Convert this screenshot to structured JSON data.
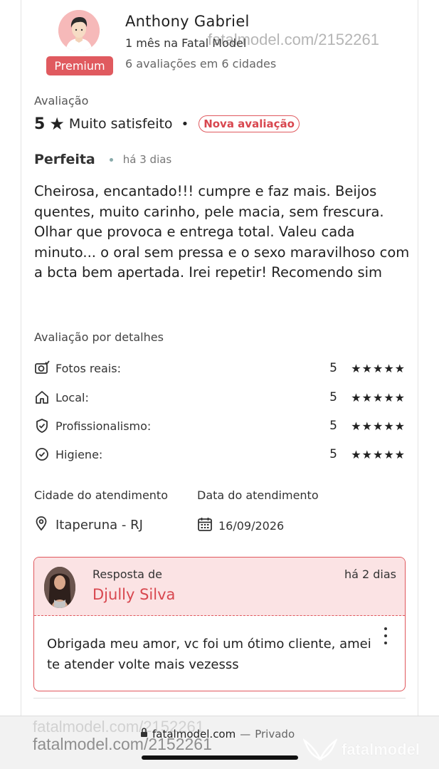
{
  "reviewer": {
    "name": "Anthony Gabriel",
    "member_since": "1 mês na Fatal Model",
    "review_count": "6 avaliações em 6 cidades",
    "badge": "Premium"
  },
  "watermark": {
    "top": "fatalmodel.com/2152261",
    "bottom": "fatalmodel.com/2152261",
    "bottom_faint": "fatalmodel.com/2152261",
    "brand": "fatalmodel"
  },
  "rating": {
    "label": "Avaliação",
    "score": "5",
    "star_icon": "star-icon",
    "text": "Muito satisfeito",
    "separator": "•",
    "new_badge": "Nova avaliação"
  },
  "review": {
    "title": "Perfeita",
    "time": "há 3 dias",
    "body": "Cheirosa, encantado!!! cumpre e faz mais. Beijos quentes, muito carinho, pele macia, sem frescura. Olhar que provoca e entrega total. Valeu cada minuto... o oral sem pressa e o sexo maravilhoso com a bcta bem apertada. Irei repetir! Recomendo sim"
  },
  "details": {
    "label": "Avaliação por detalhes",
    "items": [
      {
        "label": "Fotos reais:",
        "score": "5",
        "stars": "★★★★★",
        "icon": "camera-check-icon"
      },
      {
        "label": "Local:",
        "score": "5",
        "stars": "★★★★★",
        "icon": "home-icon"
      },
      {
        "label": "Profissionalismo:",
        "score": "5",
        "stars": "★★★★★",
        "icon": "shield-check-icon"
      },
      {
        "label": "Higiene:",
        "score": "5",
        "stars": "★★★★★",
        "icon": "check-circle-icon"
      }
    ]
  },
  "service": {
    "city_label": "Cidade do atendimento",
    "city": "Itaperuna - RJ",
    "date_label": "Data do atendimento",
    "date": "16/09/2026"
  },
  "response": {
    "label": "Resposta de",
    "name": "Djully Silva",
    "time": "há 2 dias",
    "body": "Obrigada meu amor, vc foi um ótimo cliente, amei te atender volte mais vezesss"
  },
  "browser": {
    "url": "fatalmodel.com",
    "separator": "—",
    "mode": "Privado"
  },
  "colors": {
    "accent": "#e05a5f",
    "response_bg": "#fbe3e4",
    "avatar_bg": "#f6b9b9"
  }
}
